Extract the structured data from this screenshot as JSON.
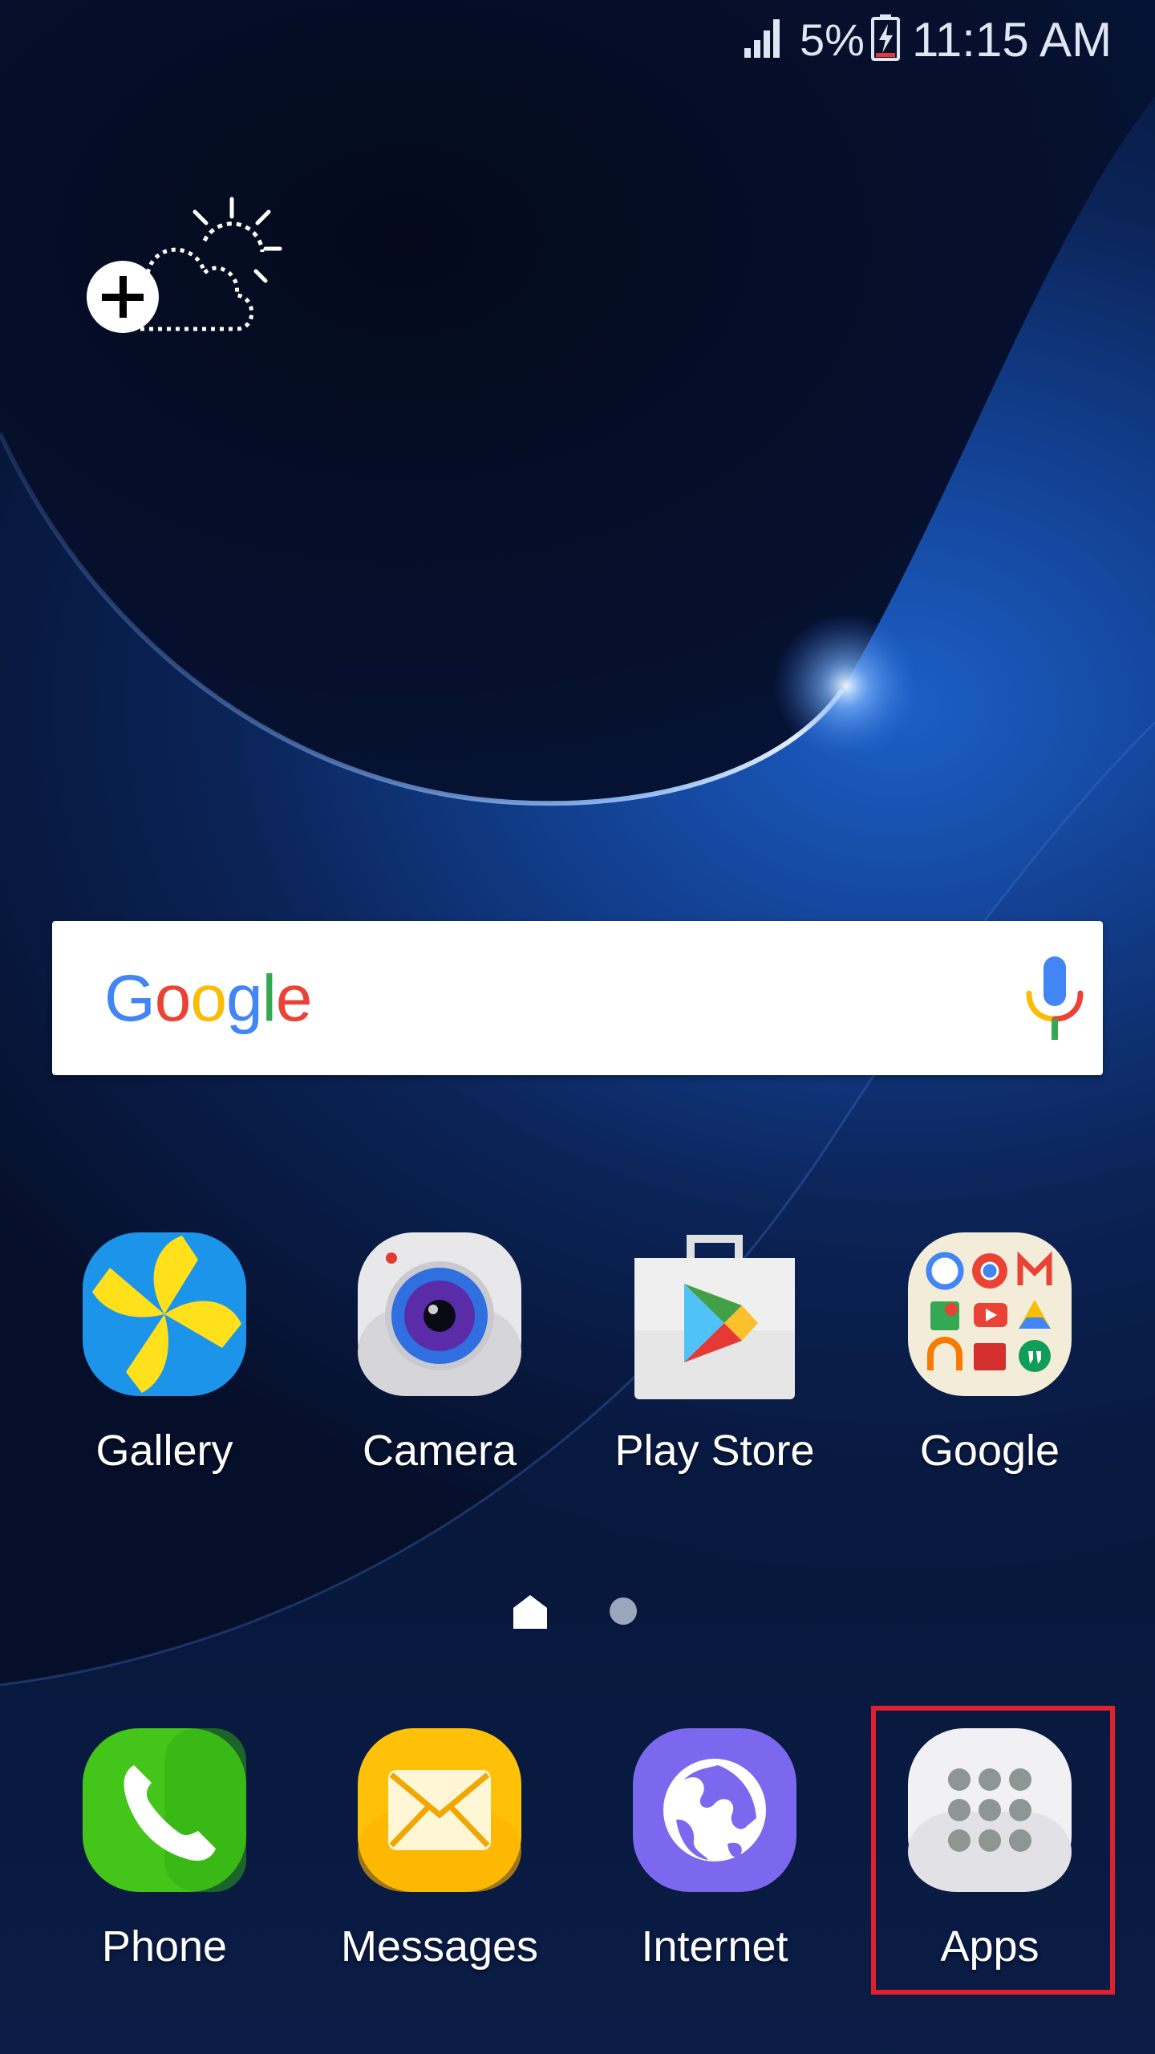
{
  "status_bar": {
    "battery_percent": "5%",
    "time": "11:15 AM"
  },
  "search": {
    "logo_letters": [
      "G",
      "o",
      "o",
      "g",
      "l",
      "e"
    ],
    "logo_colors": [
      "#4285F4",
      "#EA4335",
      "#FBBC05",
      "#4285F4",
      "#34A853",
      "#EA4335"
    ]
  },
  "home_apps": [
    {
      "label": "Gallery"
    },
    {
      "label": "Camera"
    },
    {
      "label": "Play Store"
    },
    {
      "label": "Google"
    }
  ],
  "dock_apps": [
    {
      "label": "Phone"
    },
    {
      "label": "Messages"
    },
    {
      "label": "Internet"
    },
    {
      "label": "Apps"
    }
  ],
  "colors": {
    "highlight": "#e0212d",
    "gallery": "#1e88e5",
    "messages": "#ffc107",
    "internet": "#7b68ee",
    "phone": "#43c51a"
  }
}
